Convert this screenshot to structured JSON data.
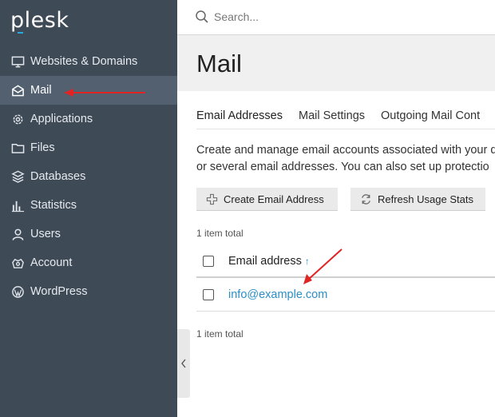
{
  "sidebar": {
    "logo": "plesk",
    "items": [
      {
        "label": "Websites & Domains",
        "icon": "monitor-icon"
      },
      {
        "label": "Mail",
        "icon": "envelope-icon",
        "active": true
      },
      {
        "label": "Applications",
        "icon": "gear-icon"
      },
      {
        "label": "Files",
        "icon": "folder-icon"
      },
      {
        "label": "Databases",
        "icon": "database-icon"
      },
      {
        "label": "Statistics",
        "icon": "bar-chart-icon"
      },
      {
        "label": "Users",
        "icon": "user-icon"
      },
      {
        "label": "Account",
        "icon": "account-icon"
      },
      {
        "label": "WordPress",
        "icon": "wordpress-icon"
      }
    ]
  },
  "header": {
    "search_placeholder": "Search..."
  },
  "page": {
    "title": "Mail",
    "tabs": [
      {
        "label": "Email Addresses",
        "active": true
      },
      {
        "label": "Mail Settings"
      },
      {
        "label": "Outgoing Mail Cont"
      }
    ],
    "description_line1": "Create and manage email accounts associated with your d",
    "description_line2": "or several email addresses. You can also set up protectio"
  },
  "toolbar": {
    "create_label": "Create Email Address",
    "refresh_label": "Refresh Usage Stats"
  },
  "table": {
    "total_top": "1 item total",
    "total_bottom": "1 item total",
    "column_header": "Email address",
    "sort_indicator": "↑",
    "rows": [
      {
        "email": "info@example.com"
      }
    ]
  },
  "colors": {
    "sidebar_bg": "#3f4a57",
    "sidebar_active": "#526070",
    "link": "#2b8fc6",
    "annotation": "#e02424"
  }
}
